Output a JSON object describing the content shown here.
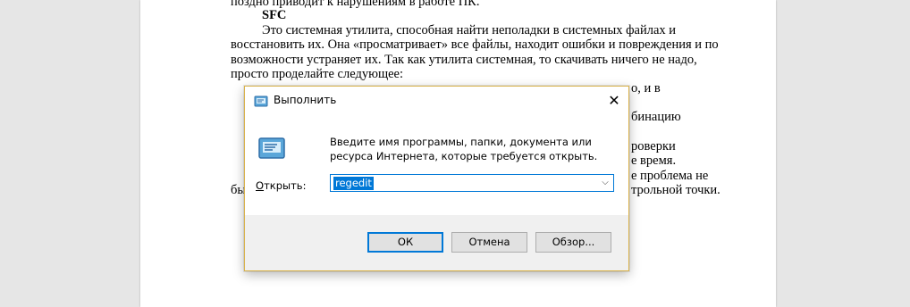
{
  "document": {
    "lines": [
      "поздно приводит к нарушениям в работе ПК.",
      "SFC",
      "Это системная утилита, способная найти неполадки в системных файлах и",
      "восстановить их. Она «просматривает» все файлы, находит ошибки и повреждения и по",
      "возможности устраняет их. Так как утилита системная, то скачивать ничего не надо,",
      "просто проделайте следующее:"
    ],
    "fragments": [
      "о, и в",
      "бинацию",
      "роверки",
      "е время.",
      "е проблема не",
      "трольной точки.",
      "бы"
    ]
  },
  "dialog": {
    "title": "Выполнить",
    "close_glyph": "✕",
    "prompt": "Введите имя программы, папки, документа или ресурса Интернета, которые требуется открыть.",
    "open_label_underlined": "О",
    "open_label_rest": "ткрыть:",
    "open_value": "regedit",
    "dropdown_glyph": "⌵",
    "buttons": {
      "ok": "ОК",
      "cancel": "Отмена",
      "browse": "Обзор..."
    }
  },
  "icons": {
    "title": "run-icon",
    "main": "run-icon-large",
    "close": "close-icon",
    "dropdown": "chevron-down-icon"
  },
  "colors": {
    "accent": "#0078d7",
    "dialog_border": "#d9b24a"
  }
}
